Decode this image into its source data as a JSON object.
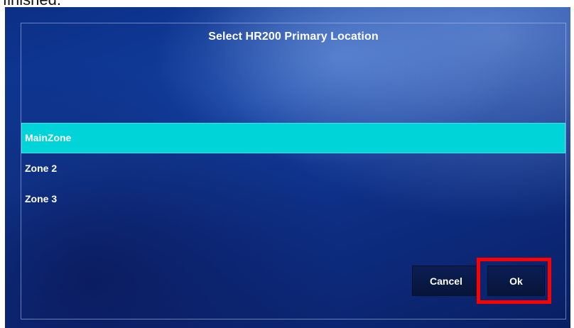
{
  "caption": {
    "text": "finished."
  },
  "dialog": {
    "title": "Select HR200 Primary Location",
    "items": [
      {
        "label": "MainZone",
        "selected": true
      },
      {
        "label": "Zone 2",
        "selected": false
      },
      {
        "label": "Zone 3",
        "selected": false
      }
    ],
    "buttons": {
      "cancel_label": "Cancel",
      "ok_label": "Ok"
    }
  },
  "colors": {
    "selected_row": "#00d4d8",
    "highlight_box": "#ff0000",
    "background_blue": "#123f9f"
  }
}
